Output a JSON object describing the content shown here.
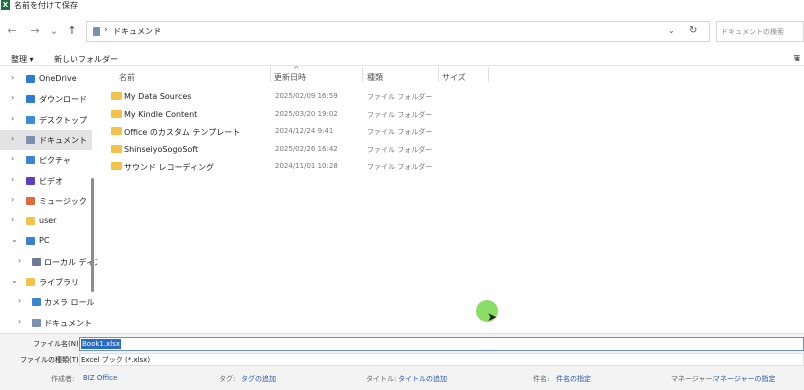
{
  "titlebar": {
    "app_icon": "X",
    "title": "名前を付けて保存"
  },
  "nav": {
    "back_icon": "←",
    "forward_icon": "→",
    "recent_icon": "⌄",
    "up_icon": "↑",
    "address": {
      "sep": "›",
      "path": "ドキュメント",
      "dropdown": "⌄",
      "refresh": "↻"
    },
    "search_placeholder": "ドキュメントの検索"
  },
  "toolbar": {
    "organize": "整理 ▾",
    "new_folder": "新しいフォルダー",
    "view_icon": "≡"
  },
  "sidebar": {
    "items": [
      {
        "label": "OneDrive",
        "chevron": "›",
        "icon": "onedrive-icon",
        "color": "#2b7cd3"
      },
      {
        "label": "ダウンロード",
        "chevron": "›",
        "icon": "download-icon",
        "color": "#2b7cd3"
      },
      {
        "label": "デスクトップ",
        "chevron": "›",
        "icon": "desktop-icon",
        "color": "#3b8ed8"
      },
      {
        "label": "ドキュメント",
        "chevron": "›",
        "icon": "documents-icon",
        "color": "#7b8fb0"
      },
      {
        "label": "ピクチャ",
        "chevron": "›",
        "icon": "pictures-icon",
        "color": "#3a86d1"
      },
      {
        "label": "ビデオ",
        "chevron": "›",
        "icon": "videos-icon",
        "color": "#5a3fc0"
      },
      {
        "label": "ミュージック",
        "chevron": "›",
        "icon": "music-icon",
        "color": "#e06b3c"
      },
      {
        "label": "user",
        "chevron": "›",
        "icon": "folder-icon",
        "color": "#f2c24a"
      },
      {
        "label": "PC",
        "chevron": "⌄",
        "icon": "pc-icon",
        "color": "#3b7fd0"
      },
      {
        "label": "ローカル ディスク",
        "chevron": "›",
        "icon": "disk-icon",
        "color": "#6b7a90"
      },
      {
        "label": "ライブラリ",
        "chevron": "⌄",
        "icon": "library-icon",
        "color": "#f2c24a"
      },
      {
        "label": "カメラ ロール",
        "chevron": "›",
        "icon": "camera-roll-icon",
        "color": "#3a86d1"
      },
      {
        "label": "ドキュメント",
        "chevron": "›",
        "icon": "documents-icon",
        "color": "#7b8fb0"
      }
    ]
  },
  "files": {
    "headers": {
      "name": "名前",
      "date": "更新日時",
      "type": "種類",
      "size": "サイズ"
    },
    "sort_caret": "^",
    "rows": [
      {
        "name": "My Data Sources",
        "date": "2025/02/09 16:59",
        "type": "ファイル フォルダー"
      },
      {
        "name": "My Kindle Content",
        "date": "2025/03/20 19:02",
        "type": "ファイル フォルダー"
      },
      {
        "name": "Office のカスタム テンプレート",
        "date": "2024/12/24 9:41",
        "type": "ファイル フォルダー"
      },
      {
        "name": "ShinseiyoSogoSoft",
        "date": "2025/02/26 16:42",
        "type": "ファイル フォルダー"
      },
      {
        "name": "サウンド レコーディング",
        "date": "2024/11/01 10:28",
        "type": "ファイル フォルダー"
      }
    ]
  },
  "save": {
    "filename_label": "ファイル名(N):",
    "filename": "Book1.xlsx",
    "filetype_label": "ファイルの種類(T):",
    "filetype": "Excel ブック (*.xlsx)",
    "author_label": "作成者:",
    "author": "BIZ Office",
    "tags_label": "タグ:",
    "tags": "タグの追加",
    "title_label": "タイトル:",
    "title": "タイトルの追加",
    "subject_label": "件名:",
    "subject": "件名の指定",
    "manager_label": "マネージャー:",
    "manager": "マネージャーの指定"
  },
  "cursor_arrow": "➤"
}
